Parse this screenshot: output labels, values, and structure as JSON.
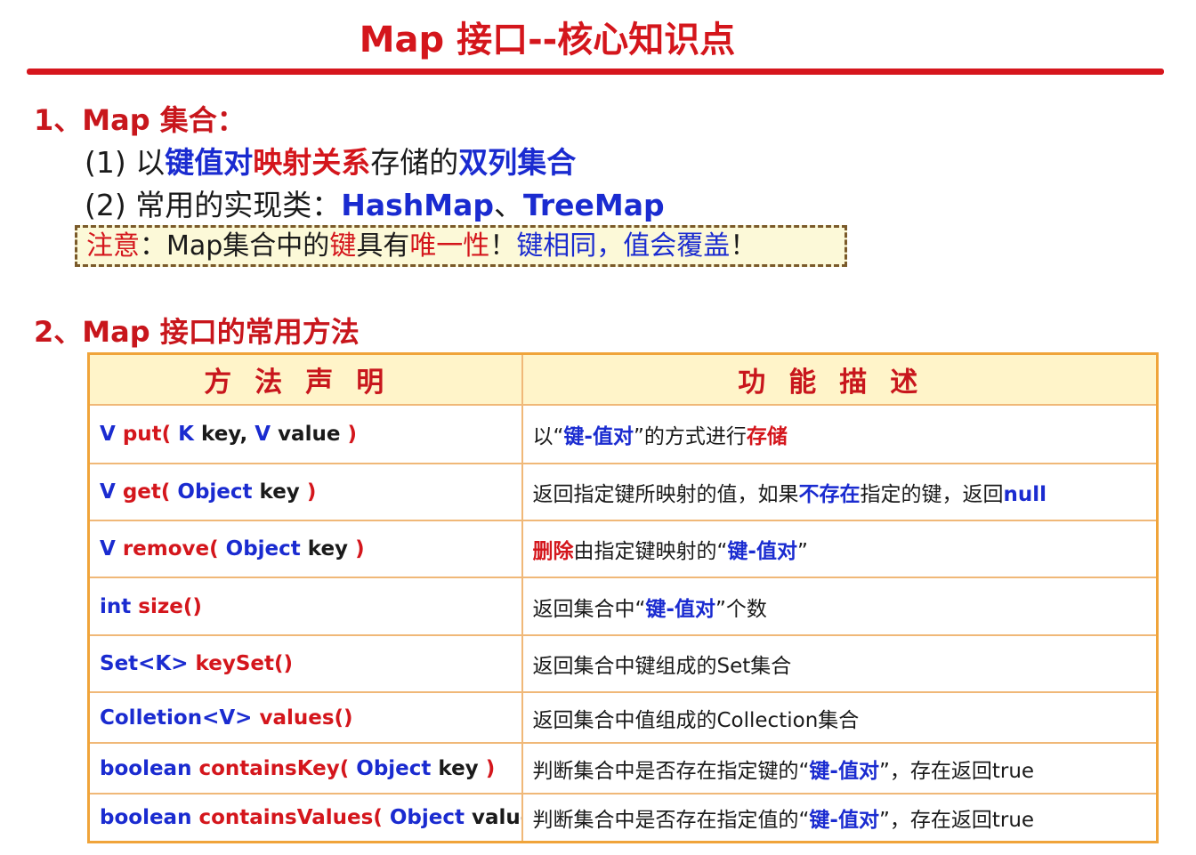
{
  "title": "Map 接口--核心知识点",
  "section1": {
    "heading": "1、Map 集合：",
    "line1": {
      "prefix": "(1)  以",
      "b1": "键值对",
      "r1": "映射关系",
      "mid": "存储的",
      "b2": "双列集合"
    },
    "line2": {
      "prefix": "(2)  常用的实现类：",
      "impl1": "HashMap",
      "sep": "、",
      "impl2": "TreeMap"
    },
    "note": {
      "label": "注意",
      "colon": "：",
      "t1": "Map集合中的",
      "key": "键",
      "t2": "具有",
      "unique": "唯一性",
      "excl": "！",
      "t3": "键相同，值会覆盖",
      "excl2": "！"
    }
  },
  "section2": {
    "heading": "2、Map 接口的常用方法",
    "headers": [
      "方法声明",
      "功能描述"
    ],
    "rows": [
      {
        "m": [
          [
            "V ",
            "blue"
          ],
          [
            "put( ",
            "red"
          ],
          [
            "K ",
            "blue"
          ],
          [
            "key, ",
            "blk"
          ],
          [
            "V ",
            "blue"
          ],
          [
            "value ",
            "blk"
          ],
          [
            ")",
            "red"
          ]
        ],
        "d": [
          [
            "以“",
            "blk"
          ],
          [
            "键-值对",
            "blue"
          ],
          [
            "”的方式进行",
            "blk"
          ],
          [
            "存储",
            "red"
          ]
        ]
      },
      {
        "m": [
          [
            "V ",
            "blue"
          ],
          [
            "get( ",
            "red"
          ],
          [
            "Object ",
            "blue"
          ],
          [
            "key ",
            "blk"
          ],
          [
            ")",
            "red"
          ]
        ],
        "d": [
          [
            "返回指定键所映射的值，如果",
            "blk"
          ],
          [
            "不存在",
            "blue"
          ],
          [
            "指定的键，返回",
            "blk"
          ],
          [
            "null",
            "blue"
          ]
        ]
      },
      {
        "m": [
          [
            "V ",
            "blue"
          ],
          [
            "remove( ",
            "red"
          ],
          [
            "Object ",
            "blue"
          ],
          [
            "key ",
            "blk"
          ],
          [
            ")",
            "red"
          ]
        ],
        "d": [
          [
            "删除",
            "red"
          ],
          [
            "由指定键映射的“",
            "blk"
          ],
          [
            "键-值对",
            "blue"
          ],
          [
            "”",
            "blk"
          ]
        ]
      },
      {
        "m": [
          [
            "int ",
            "blue"
          ],
          [
            "size()",
            "red"
          ]
        ],
        "d": [
          [
            "返回集合中“",
            "blk"
          ],
          [
            "键-值对",
            "blue"
          ],
          [
            "”个数",
            "blk"
          ]
        ]
      },
      {
        "m": [
          [
            "Set<K> ",
            "blue"
          ],
          [
            "keySet()",
            "red"
          ]
        ],
        "d": [
          [
            "返回集合中键组成的Set集合",
            "blk"
          ]
        ]
      },
      {
        "m": [
          [
            "Colletion<V> ",
            "blue"
          ],
          [
            "values()",
            "red"
          ]
        ],
        "d": [
          [
            "返回集合中值组成的Collection集合",
            "blk"
          ]
        ]
      },
      {
        "m": [
          [
            "boolean ",
            "blue"
          ],
          [
            "containsKey( ",
            "red"
          ],
          [
            "Object ",
            "blue"
          ],
          [
            "key ",
            "blk"
          ],
          [
            ")",
            "red"
          ]
        ],
        "d": [
          [
            "判断集合中是否存在指定键的“",
            "blk"
          ],
          [
            "键-值对",
            "blue"
          ],
          [
            "”，存在返回true",
            "blk"
          ]
        ]
      },
      {
        "m": [
          [
            "boolean ",
            "blue"
          ],
          [
            "containsValues( ",
            "red"
          ],
          [
            "Object ",
            "blue"
          ],
          [
            "value ",
            "blk"
          ],
          [
            ")",
            "red"
          ]
        ],
        "d": [
          [
            "判断集合中是否存在指定值的“",
            "blk"
          ],
          [
            "键-值对",
            "blue"
          ],
          [
            "”，存在返回true",
            "blk"
          ]
        ]
      }
    ]
  }
}
